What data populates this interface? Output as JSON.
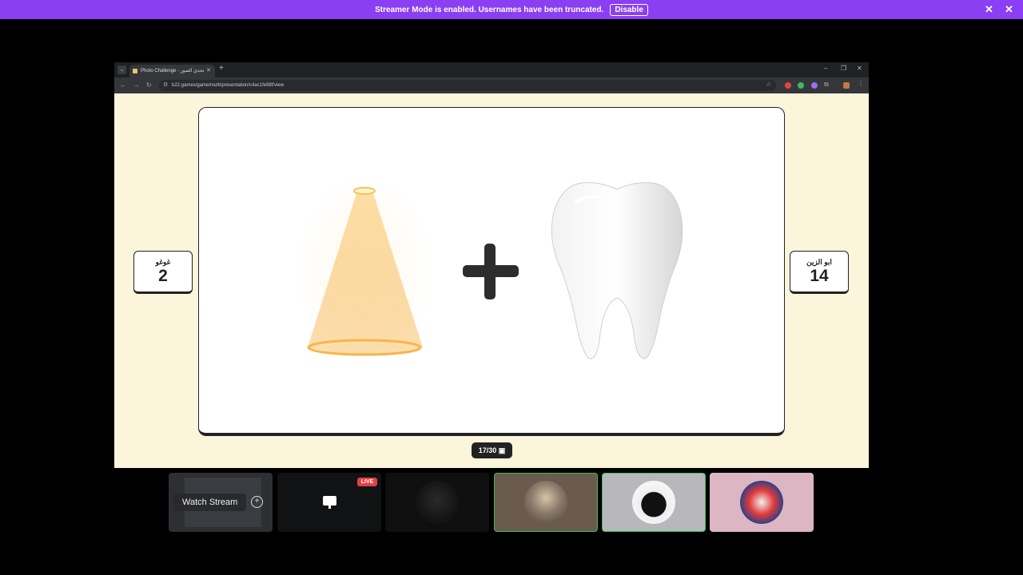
{
  "banner": {
    "message": "Streamer Mode is enabled. Usernames have been truncated.",
    "disable_label": "Disable"
  },
  "browser": {
    "tab_title": "Photo Challenge - تحدي الصور",
    "url": "b22.games/game/multi/presentation/c4ac1fe98f/view"
  },
  "game": {
    "left_player": {
      "name": "غوغو",
      "score": "2"
    },
    "right_player": {
      "name": "ابو الزين",
      "score": "14"
    },
    "counter": "17/30",
    "clue_left": "spotlight-cone",
    "clue_right": "tooth"
  },
  "call": {
    "watch_label": "Watch Stream",
    "live_badge": "LIVE"
  },
  "colors": {
    "banner": "#8a3ff3",
    "page_bg": "#fbf5dc",
    "speaking_border": "#3fbb5a",
    "live": "#e23f44"
  }
}
